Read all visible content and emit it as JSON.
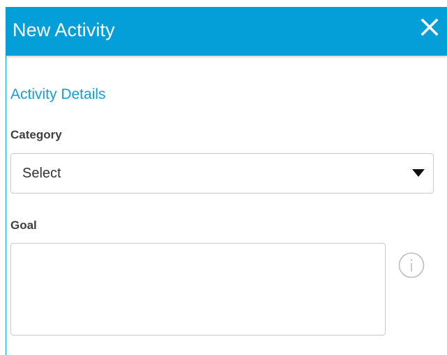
{
  "dialog": {
    "title": "New Activity",
    "close_icon": "close-icon"
  },
  "section": {
    "title": "Activity Details"
  },
  "category": {
    "label": "Category",
    "selected_value": "Select",
    "arrow_icon": "caret-down-icon"
  },
  "goal": {
    "label": "Goal",
    "value": "",
    "info_icon": "info-icon"
  },
  "colors": {
    "header_bg": "#049ed8",
    "accent_text": "#129fd3",
    "border": "#c9c9c9"
  }
}
